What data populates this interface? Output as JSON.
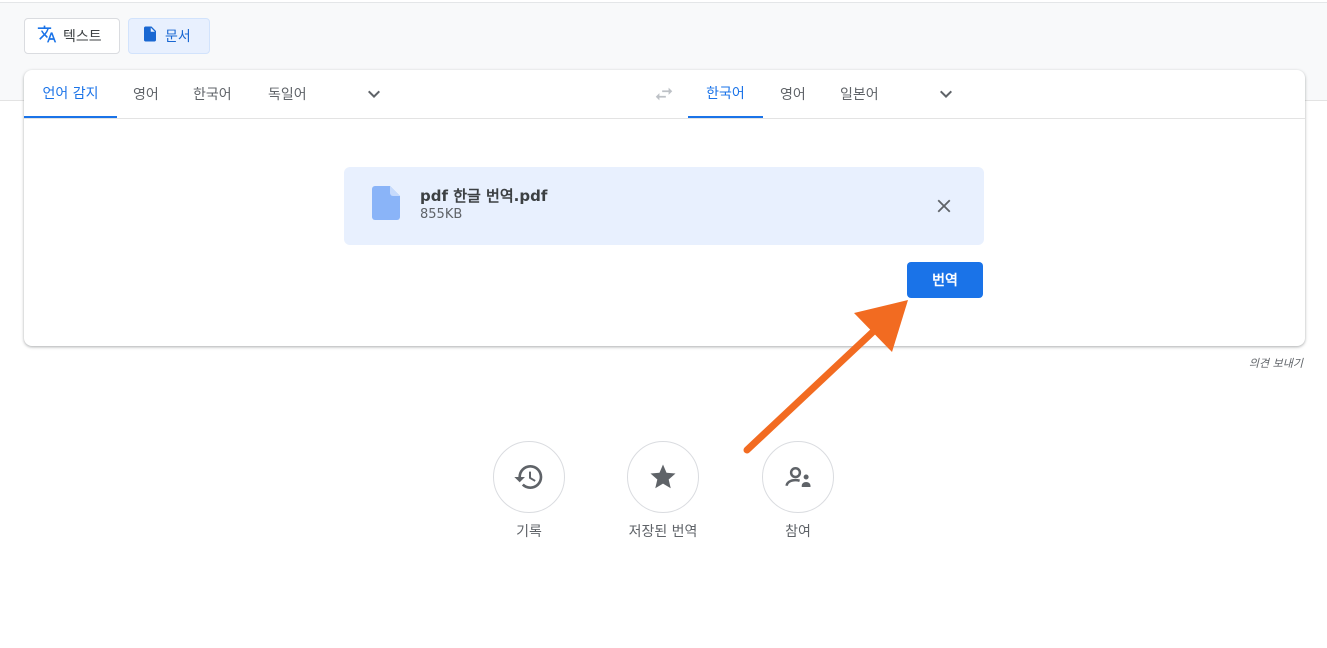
{
  "mode_tabs": {
    "text_label": "텍스트",
    "document_label": "문서"
  },
  "source_langs": {
    "items": [
      "언어 감지",
      "영어",
      "한국어",
      "독일어"
    ],
    "active_index": 0
  },
  "target_langs": {
    "items": [
      "한국어",
      "영어",
      "일본어"
    ],
    "active_index": 0
  },
  "file": {
    "name": "pdf 한글 번역.pdf",
    "size": "855KB"
  },
  "translate_button": "번역",
  "feedback_link": "의견 보내기",
  "bottom_actions": [
    {
      "label": "기록",
      "icon": "history-icon"
    },
    {
      "label": "저장된 번역",
      "icon": "star-icon"
    },
    {
      "label": "참여",
      "icon": "community-icon"
    }
  ],
  "colors": {
    "accent": "#1a73e8",
    "file_bg": "#e8f0fe",
    "annotation_arrow": "#f26b21"
  }
}
